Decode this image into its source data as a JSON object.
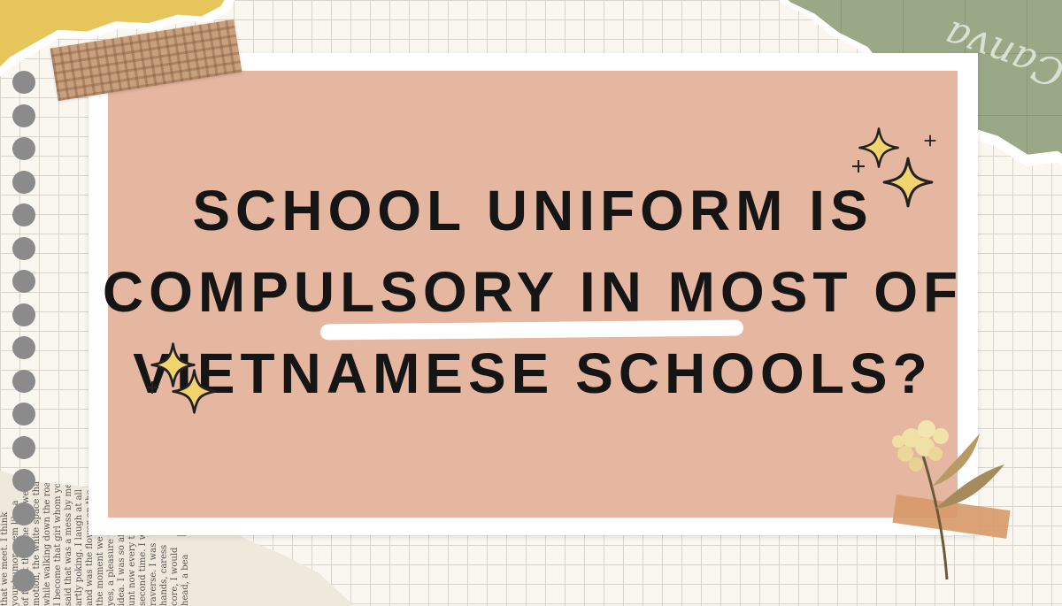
{
  "headline": {
    "line1": "School uniform is",
    "line2": "compulsory in most of",
    "line3": "Vietnamese schools?"
  },
  "watermark": "Canva",
  "newspaper_text": "that we meet. I think\nyour humor seem like a\nof forget the time that we\nmotion, the white space that\nwhile walking down the road\nI become that girl whom you\nsaid that was a mess by me\nartly poking. I laugh at all\nand was the flower on the way\nthe moment we hold hands\nyes, a pleasure that I took\nidea. I was so afraid to\nunt now every time you see\nsecond time. I would\nraverse. I was\nhands, caress\ncore, I would\nhead, a bea",
  "colors": {
    "card": "#e5b6a0",
    "yellow_paper": "#e6c65a",
    "green_paper": "#9aa888",
    "sparkle": "#f3d36b",
    "text": "#151515"
  },
  "icons": [
    "sparkle-icon",
    "flower-icon",
    "binder-hole-icon",
    "tape-icon"
  ]
}
